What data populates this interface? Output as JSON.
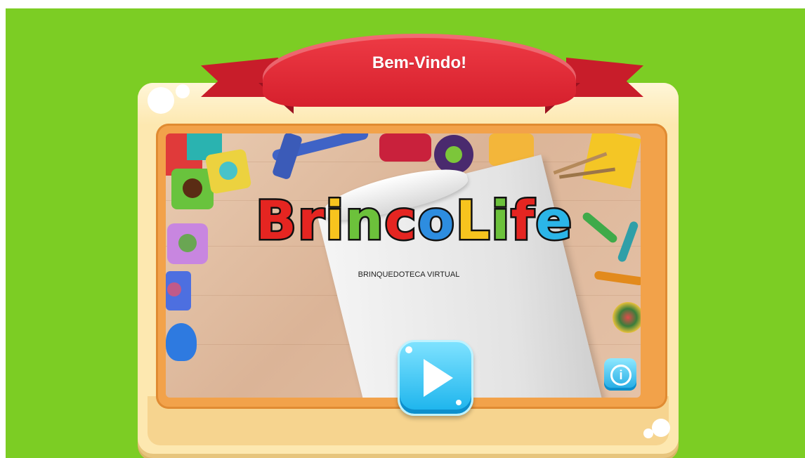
{
  "banner": {
    "title": "Bem-Vindo!"
  },
  "logo": {
    "letters": [
      {
        "char": "B",
        "color": "#e52521"
      },
      {
        "char": "r",
        "color": "#e52521"
      },
      {
        "char": "i",
        "color": "#f7c41e"
      },
      {
        "char": "n",
        "color": "#6cc13b"
      },
      {
        "char": "c",
        "color": "#e52521"
      },
      {
        "char": "o",
        "color": "#2d8de0"
      },
      {
        "char": "L",
        "color": "#f7c41e"
      },
      {
        "char": "i",
        "color": "#6cc13b"
      },
      {
        "char": "f",
        "color": "#e52521"
      },
      {
        "char": "e",
        "color": "#2bb5e8"
      }
    ],
    "subtitle": "BRINQUEDOTECA VIRTUAL"
  },
  "buttons": {
    "play": {
      "icon": "play-icon"
    },
    "info": {
      "icon": "info-icon",
      "glyph": "i"
    }
  },
  "colors": {
    "background": "#7ccd24",
    "ribbon": "#e22b36",
    "frame": "#f2a24a",
    "board": "#fde8b0",
    "button": "#1ab3ec"
  }
}
